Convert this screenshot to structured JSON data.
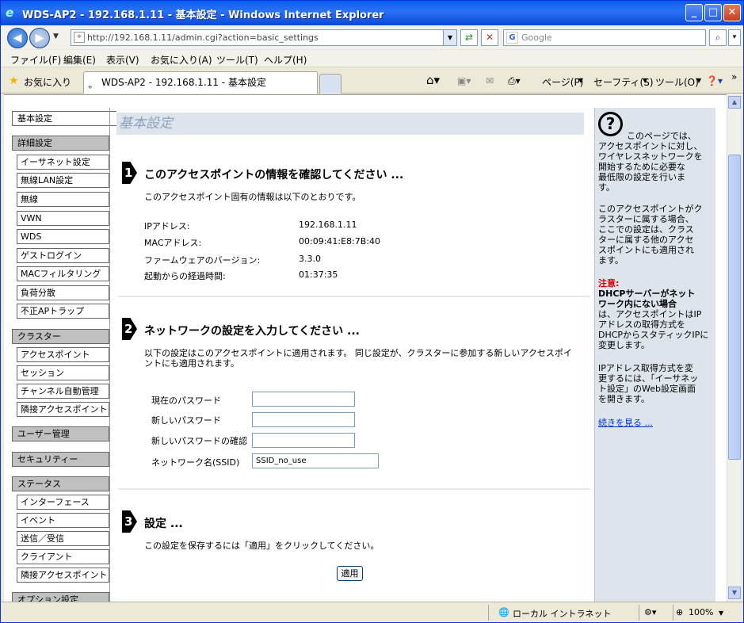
{
  "window": {
    "title": "WDS-AP2 - 192.168.1.11 - 基本設定 - Windows Internet Explorer"
  },
  "address": {
    "url": "http://192.168.1.11/admin.cgi?action=basic_settings",
    "search_placeholder": "Google"
  },
  "menu": [
    "ファイル(F)",
    "編集(E)",
    "表示(V)",
    "お気に入り(A)",
    "ツール(T)",
    "ヘルプ(H)"
  ],
  "favbar": {
    "favorites": "お気に入り",
    "tab": "WDS-AP2 - 192.168.1.11 - 基本設定",
    "page": "ページ(P)",
    "safety": "セーフティ(S)",
    "tools": "ツール(O)"
  },
  "sidebar": {
    "current": "基本設定",
    "groups": [
      {
        "label": "詳細設定",
        "items": [
          "イーサネット設定",
          "無線LAN設定",
          "無線",
          "VWN",
          "WDS",
          "ゲストログイン",
          "MACフィルタリング",
          "負荷分散",
          "不正APトラップ"
        ]
      },
      {
        "label": "クラスター",
        "items": [
          "アクセスポイント",
          "セッション",
          "チャンネル自動管理",
          "隣接アクセスポイント"
        ]
      },
      {
        "label": "ユーザー管理",
        "items": []
      },
      {
        "label": "セキュリティー",
        "items": []
      },
      {
        "label": "ステータス",
        "items": [
          "インターフェース",
          "イベント",
          "送信／受信",
          "クライアント",
          "隣接アクセスポイント"
        ]
      },
      {
        "label": "オプション設定",
        "items": []
      }
    ]
  },
  "main": {
    "title": "基本設定",
    "sec1": {
      "num": "1",
      "heading": "このアクセスポイントの情報を確認してください ...",
      "desc": "このアクセスポイント固有の情報は以下のとおりです。",
      "rows": [
        {
          "k": "IPアドレス:",
          "v": "192.168.1.11"
        },
        {
          "k": "MACアドレス:",
          "v": "00:09:41:E8:7B:40"
        },
        {
          "k": "ファームウェアのバージョン:",
          "v": "3.3.0"
        },
        {
          "k": "起動からの経過時間:",
          "v": "01:37:35"
        }
      ]
    },
    "sec2": {
      "num": "2",
      "heading": "ネットワークの設定を入力してください ...",
      "desc1": "以下の設定はこのアクセスポイントに適用されます。 同じ設定が、クラスターに参加する新しいアクセスポイ",
      "desc2": "ントにも適用されます。",
      "current_pw": "現在のパスワード",
      "new_pw": "新しいパスワード",
      "confirm_pw": "新しいパスワードの確認",
      "ssid_label": "ネットワーク名(SSID)",
      "ssid_value": "SSID_no_use"
    },
    "sec3": {
      "num": "3",
      "heading": "設定 ...",
      "desc": "この設定を保存するには「適用」をクリックしてください。",
      "apply": "適用"
    }
  },
  "help": {
    "p1": [
      "このページでは、",
      "アクセスポイントに対し、",
      "ワイヤレスネットワークを",
      "開始するために必要な",
      "最低限の設定を行いま",
      "す。"
    ],
    "p2": [
      "このアクセスポイントがク",
      "ラスターに属する場合、",
      "ここでの設定は、クラス",
      "ターに属する他のアクセ",
      "スポイントにも適用され",
      "ます。"
    ],
    "warn": "注意:",
    "bold": [
      "DHCPサーバーがネット",
      "ワーク内にない場合"
    ],
    "p3": [
      "は、アクセスポイントはIP",
      "アドレスの取得方式を",
      "DHCPからスタティックIPに",
      "変更します。"
    ],
    "p4": [
      "IPアドレス取得方式を変",
      "更するには、「イーサネッ",
      "ト設定」のWeb設定画面",
      "を開きます。"
    ],
    "more": "続きを見る ..."
  },
  "status": {
    "zone": "ローカル イントラネット",
    "zoom": "100%"
  }
}
